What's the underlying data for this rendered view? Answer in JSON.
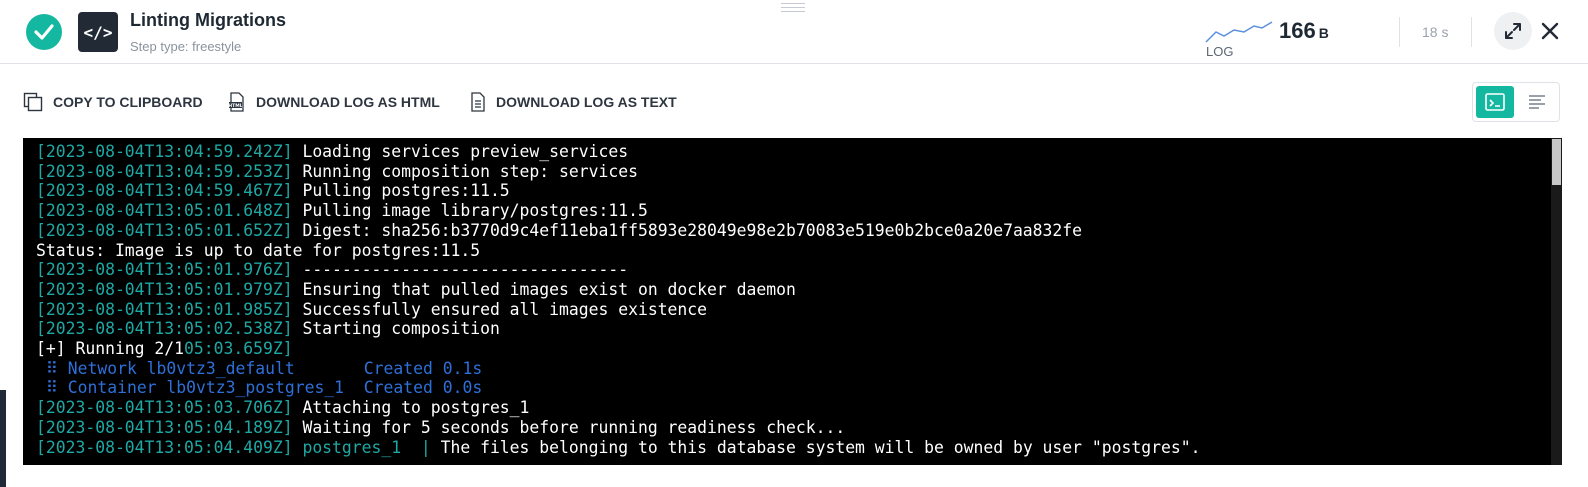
{
  "header": {
    "title": "Linting Migrations",
    "step_type": "Step type: freestyle",
    "log_label": "LOG",
    "log_size_value": "166",
    "log_size_unit": "B",
    "duration": "18 s"
  },
  "toolbar": {
    "copy_label": "COPY TO CLIPBOARD",
    "download_html_label": "DOWNLOAD LOG AS HTML",
    "download_text_label": "DOWNLOAD LOG AS TEXT"
  },
  "colors": {
    "accent": "#14b8a0",
    "timestamp": "#1ea8a4",
    "compose_blue": "#2e6fd8",
    "terminal_bg": "#000000"
  },
  "icons": {
    "status": "check-circle-icon",
    "step": "code-icon",
    "expand": "expand-icon",
    "close": "close-icon",
    "copy": "copy-icon",
    "download_html": "html-file-icon",
    "download_text": "text-file-icon",
    "terminal_view": "terminal-icon",
    "text_view": "align-left-icon"
  },
  "log": {
    "l0_ts": "[2023-08-04T13:04:59.242Z]",
    "l0_msg": " Loading services preview_services",
    "l1_ts": "[2023-08-04T13:04:59.253Z]",
    "l1_msg": " Running composition step: services",
    "l2_ts": "[2023-08-04T13:04:59.467Z]",
    "l2_msg": " Pulling postgres:11.5",
    "l3_ts": "[2023-08-04T13:05:01.648Z]",
    "l3_msg": " Pulling image library/postgres:11.5",
    "l4_ts": "[2023-08-04T13:05:01.652Z]",
    "l4_msg": " Digest: sha256:b3770d9c4ef11eba1ff5893e28049e98e2b70083e519e0b2bce0a20e7aa832fe",
    "l5_msg": "Status: Image is up to date for postgres:11.5",
    "l6_ts": "[2023-08-04T13:05:01.976Z]",
    "l6_msg": " ---------------------------------",
    "l7_ts": "[2023-08-04T13:05:01.979Z]",
    "l7_msg": " Ensuring that pulled images exist on docker daemon",
    "l8_ts": "[2023-08-04T13:05:01.985Z]",
    "l8_msg": " Successfully ensured all images existence",
    "l9_ts": "[2023-08-04T13:05:02.538Z]",
    "l9_msg": " Starting composition",
    "l10_msg": "[+] Running 2/1",
    "l10_ts": "05:03.659Z]",
    "l11_text": " ⠿ Network lb0vtz3_default       Created 0.1s",
    "l12_text": " ⠿ Container lb0vtz3_postgres_1  Created 0.0s",
    "l13_ts": "[2023-08-04T13:05:03.706Z]",
    "l13_msg": " Attaching to postgres_1",
    "l14_ts": "[2023-08-04T13:05:04.189Z]",
    "l14_msg": " Waiting for 5 seconds before running readiness check...",
    "l15_ts": "[2023-08-04T13:05:04.409Z]",
    "l15_svc": " postgres_1  |",
    "l15_msg": " The files belonging to this database system will be owned by user \"postgres\"."
  }
}
